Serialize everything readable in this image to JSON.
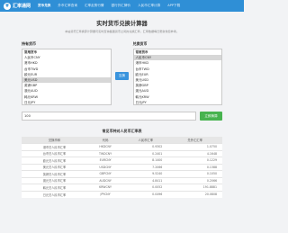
{
  "header": {
    "logo_text": "汇率通网",
    "nav": [
      "货币兑换",
      "外币汇率查询",
      "汇率走势行情",
      "银行外汇牌价",
      "人民币汇率计算",
      "APP下载"
    ]
  },
  "title": "实时货币兑换计算器",
  "subtitle": "本站货币汇率换算计算器可实时查询各国货币之间的兑换汇率，汇率数据每日更新供您参考。",
  "from_panel": {
    "label": "持有货币",
    "items": [
      "常用货币",
      "人民币CNY",
      "港币HKD",
      "台币TWD",
      "欧元EUR",
      "美元USD",
      "英镑GBP",
      "澳元AUD",
      "韩元KRW",
      "日元JPY"
    ]
  },
  "swap_label": "互换",
  "to_panel": {
    "label": "兑换货币",
    "items": [
      "常用货币",
      "人民币CNY",
      "港币HKD",
      "台币TWD",
      "欧元EUR",
      "美元USD",
      "英镑GBP",
      "澳元AUD",
      "韩元KRW",
      "日元JPY"
    ]
  },
  "amount": "100",
  "calc_label": "立即换算",
  "table": {
    "title": "常见币种对人民币汇率表",
    "headers": [
      "兑换币种",
      "代码",
      "人民币汇率",
      "兑外汇汇率"
    ],
    "rows": [
      [
        "港币兑人民币汇率",
        "HKDCNY",
        "0.9302",
        "1.0750"
      ],
      [
        "台币兑人民币汇率",
        "TWDCNY",
        "0.2401",
        "4.1648"
      ],
      [
        "欧元兑人民币汇率",
        "EURCNY",
        "8.1400",
        "0.1229"
      ],
      [
        "美元兑人民币汇率",
        "USDCNY",
        "7.2066",
        "0.1388"
      ],
      [
        "英镑兑人民币汇率",
        "GBPCNY",
        "9.5240",
        "0.1050"
      ],
      [
        "澳元兑人民币汇率",
        "AUDCNY",
        "4.8411",
        "0.2066"
      ],
      [
        "韩元兑人民币汇率",
        "KRWCNY",
        "0.0052",
        "191.8881"
      ],
      [
        "日元兑人民币汇率",
        "JPYCNY",
        "0.0496",
        "20.0808"
      ]
    ]
  }
}
